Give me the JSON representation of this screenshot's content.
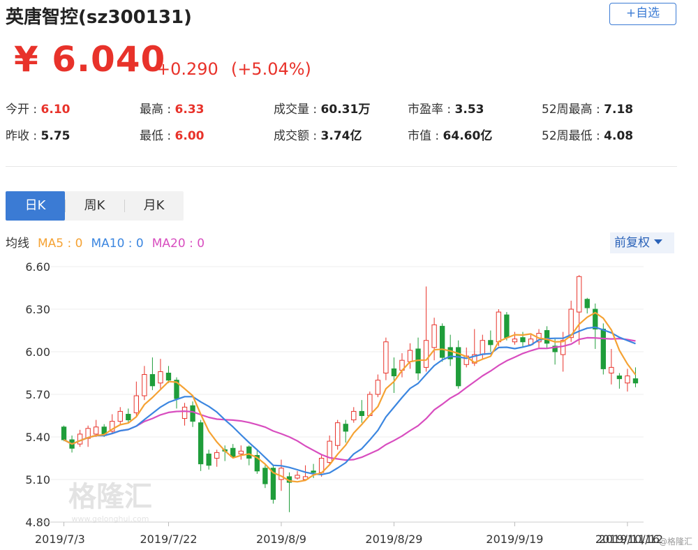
{
  "header": {
    "title": "英唐智控(sz300131)",
    "watch_label": "+自选"
  },
  "quote": {
    "price": "¥ 6.040",
    "change": "+0.290",
    "change_pct": "(+5.04%)"
  },
  "stats": [
    [
      {
        "label": "今开 : ",
        "value": "6.10",
        "tone": "red"
      },
      {
        "label": "最高 : ",
        "value": "6.33",
        "tone": "red"
      },
      {
        "label": "成交量 : ",
        "value": "60.31万",
        "tone": "dark"
      },
      {
        "label": "市盈率 : ",
        "value": "3.53",
        "tone": "dark"
      },
      {
        "label": "52周最高 : ",
        "value": "7.18",
        "tone": "dark"
      }
    ],
    [
      {
        "label": "昨收 : ",
        "value": "5.75",
        "tone": "dark"
      },
      {
        "label": "最低 : ",
        "value": "6.00",
        "tone": "red"
      },
      {
        "label": "成交额 : ",
        "value": "3.74亿",
        "tone": "dark"
      },
      {
        "label": "市值 : ",
        "value": "64.60亿",
        "tone": "dark"
      },
      {
        "label": "52周最低 : ",
        "value": "4.08",
        "tone": "dark"
      }
    ]
  ],
  "tabs": [
    "日K",
    "周K",
    "月K"
  ],
  "ma_legend": {
    "prefix": "均线",
    "ma5": "MA5 : 0",
    "ma10": "MA10 : 0",
    "ma20": "MA20 : 0"
  },
  "adjust_label": "前复权",
  "watermark": "格隆汇",
  "watermark_sub": "www.gelonghui.com",
  "footer_mark": "@格隆汇",
  "colors": {
    "up": "#e8322a",
    "down": "#1f9d3a",
    "ma5": "#f5a233",
    "ma10": "#3b86e0",
    "ma20": "#d84dbf",
    "accent": "#3b7bd4"
  },
  "chart_data": {
    "type": "candlestick",
    "ylim": [
      4.8,
      6.6
    ],
    "y_ticks": [
      "6.60",
      "6.30",
      "6.00",
      "5.70",
      "5.40",
      "5.10",
      "4.80"
    ],
    "x_ticks": [
      {
        "label": "2019/7/3",
        "index": 0
      },
      {
        "label": "2019/7/22",
        "index": 13
      },
      {
        "label": "2019/8/9",
        "index": 27
      },
      {
        "label": "2019/8/29",
        "index": 41
      },
      {
        "label": "2019/9/19",
        "index": 56
      },
      {
        "label": "2019/10/16",
        "index": 70
      },
      {
        "label": "2019/11/12",
        "index": 89
      }
    ],
    "candles": [
      [
        5.47,
        5.38,
        5.48,
        5.37
      ],
      [
        5.38,
        5.32,
        5.41,
        5.29
      ],
      [
        5.35,
        5.42,
        5.45,
        5.33
      ],
      [
        5.39,
        5.46,
        5.48,
        5.33
      ],
      [
        5.42,
        5.47,
        5.52,
        5.4
      ],
      [
        5.47,
        5.41,
        5.49,
        5.4
      ],
      [
        5.44,
        5.51,
        5.56,
        5.42
      ],
      [
        5.51,
        5.58,
        5.61,
        5.49
      ],
      [
        5.56,
        5.52,
        5.6,
        5.5
      ],
      [
        5.57,
        5.69,
        5.79,
        5.55
      ],
      [
        5.69,
        5.84,
        5.9,
        5.66
      ],
      [
        5.84,
        5.76,
        5.96,
        5.73
      ],
      [
        5.78,
        5.86,
        5.95,
        5.74
      ],
      [
        5.85,
        5.8,
        5.9,
        5.78
      ],
      [
        5.8,
        5.67,
        5.82,
        5.6
      ],
      [
        5.53,
        5.61,
        5.64,
        5.48
      ],
      [
        5.62,
        5.51,
        5.65,
        5.47
      ],
      [
        5.5,
        5.21,
        5.52,
        5.16
      ],
      [
        5.28,
        5.2,
        5.31,
        5.17
      ],
      [
        5.25,
        5.29,
        5.31,
        5.19
      ],
      [
        5.31,
        5.3,
        5.34,
        5.23
      ],
      [
        5.32,
        5.26,
        5.35,
        5.25
      ],
      [
        5.28,
        5.3,
        5.34,
        5.24
      ],
      [
        5.33,
        5.25,
        5.34,
        5.2
      ],
      [
        5.27,
        5.16,
        5.31,
        5.14
      ],
      [
        5.18,
        5.07,
        5.2,
        5.04
      ],
      [
        5.18,
        4.96,
        5.2,
        4.93
      ],
      [
        5.1,
        5.18,
        5.24,
        5.02
      ],
      [
        5.12,
        5.08,
        5.15,
        4.87
      ],
      [
        5.11,
        5.13,
        5.16,
        5.1
      ],
      [
        5.1,
        5.12,
        5.2,
        5.09
      ],
      [
        5.16,
        5.15,
        5.21,
        5.11
      ],
      [
        5.15,
        5.25,
        5.27,
        5.12
      ],
      [
        5.22,
        5.37,
        5.41,
        5.2
      ],
      [
        5.34,
        5.5,
        5.52,
        5.31
      ],
      [
        5.49,
        5.44,
        5.52,
        5.36
      ],
      [
        5.52,
        5.58,
        5.61,
        5.5
      ],
      [
        5.58,
        5.55,
        5.66,
        5.5
      ],
      [
        5.55,
        5.7,
        5.72,
        5.55
      ],
      [
        5.7,
        5.8,
        5.84,
        5.68
      ],
      [
        5.85,
        6.07,
        6.1,
        5.8
      ],
      [
        5.88,
        5.83,
        5.96,
        5.71
      ],
      [
        5.87,
        5.94,
        5.99,
        5.82
      ],
      [
        5.93,
        6.01,
        6.06,
        5.88
      ],
      [
        6.02,
        5.85,
        6.1,
        5.8
      ],
      [
        5.89,
        6.08,
        6.46,
        5.86
      ],
      [
        6.03,
        6.19,
        6.24,
        5.94
      ],
      [
        6.18,
        5.96,
        6.2,
        5.93
      ],
      [
        6.03,
        5.95,
        6.12,
        5.9
      ],
      [
        6.03,
        5.76,
        6.08,
        5.74
      ],
      [
        5.91,
        5.97,
        6.03,
        5.89
      ],
      [
        5.92,
        5.98,
        6.16,
        5.9
      ],
      [
        5.98,
        6.08,
        6.12,
        5.95
      ],
      [
        6.08,
        6.05,
        6.15,
        6.0
      ],
      [
        6.07,
        6.28,
        6.3,
        6.04
      ],
      [
        6.26,
        6.1,
        6.28,
        6.08
      ],
      [
        6.07,
        6.09,
        6.14,
        6.05
      ],
      [
        6.1,
        6.07,
        6.14,
        6.03
      ],
      [
        6.05,
        6.09,
        6.12,
        6.05
      ],
      [
        6.07,
        6.13,
        6.16,
        6.03
      ],
      [
        6.15,
        6.06,
        6.18,
        6.02
      ],
      [
        6.04,
        6.0,
        6.09,
        5.91
      ],
      [
        5.98,
        6.08,
        6.14,
        5.86
      ],
      [
        6.1,
        6.3,
        6.36,
        6.07
      ],
      [
        6.28,
        6.53,
        6.54,
        6.05
      ],
      [
        6.37,
        6.31,
        6.38,
        6.27
      ],
      [
        6.3,
        6.16,
        6.34,
        6.02
      ],
      [
        6.16,
        5.88,
        6.2,
        5.84
      ],
      [
        5.85,
        5.89,
        6.02,
        5.77
      ],
      [
        5.83,
        5.81,
        5.85,
        5.74
      ],
      [
        5.78,
        5.83,
        5.88,
        5.72
      ],
      [
        5.81,
        5.78,
        5.89,
        5.75
      ]
    ]
  }
}
